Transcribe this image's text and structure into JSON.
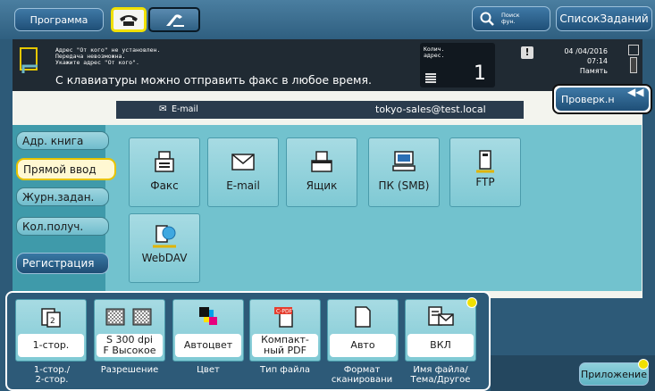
{
  "topbar": {
    "program_label": "Программа",
    "search_label": "Поиск\nфун.",
    "job_list_label": "СписокЗаданий"
  },
  "status": {
    "message_lines": "Адрес \"От кого\" не установлен.\nПередача невозможна.\nУкажите адрес \"От кого\".",
    "main_message": "С клавиатуры можно отправить факс в любое время.",
    "dest_count_label": "Колич.\nадрес.",
    "dest_count": "1",
    "date": "04 /04/2016",
    "time": "07:14",
    "memory_label": "Память",
    "check_label": "Проверк.н",
    "warning_icon": "!"
  },
  "destination": {
    "type_label": "E-mail",
    "address": "tokyo-sales@test.local"
  },
  "nav": {
    "items": [
      "Адр. книга",
      "Прямой ввод",
      "Журн.задан.",
      "Кол.получ."
    ],
    "register_label": "Регистрация"
  },
  "tiles": [
    {
      "label": "Факс",
      "icon": "fax-icon"
    },
    {
      "label": "E-mail",
      "icon": "envelope-icon"
    },
    {
      "label": "Ящик",
      "icon": "box-icon"
    },
    {
      "label": "ПК (SMB)",
      "icon": "pc-icon"
    },
    {
      "label": "FTP",
      "icon": "ftp-icon"
    },
    {
      "label": "WebDAV",
      "icon": "webdav-icon"
    }
  ],
  "options": [
    {
      "value": "1-стор.",
      "caption": "1-стор./\n2-стор.",
      "icon": "duplex-icon"
    },
    {
      "value": "S 300 dpi\nF Высокое",
      "caption": "Разрешение",
      "icon": "resolution-icon"
    },
    {
      "value": "Автоцвет",
      "caption": "Цвет",
      "icon": "color-icon"
    },
    {
      "value": "Компакт-\nный PDF",
      "caption": "Тип файла",
      "icon": "pdf-icon",
      "icon_text": "C-PDF"
    },
    {
      "value": "Авто",
      "caption": "Формат\nсканировани",
      "icon": "page-icon"
    },
    {
      "value": "ВКЛ",
      "caption": "Имя файла/\nТема/Другое",
      "icon": "doc-mail-icon"
    }
  ],
  "app_label": "Приложение",
  "colors": {
    "accent_yellow": "#f0e000",
    "tile_blue": "#7fc9d4",
    "status_bg": "#202a33"
  }
}
